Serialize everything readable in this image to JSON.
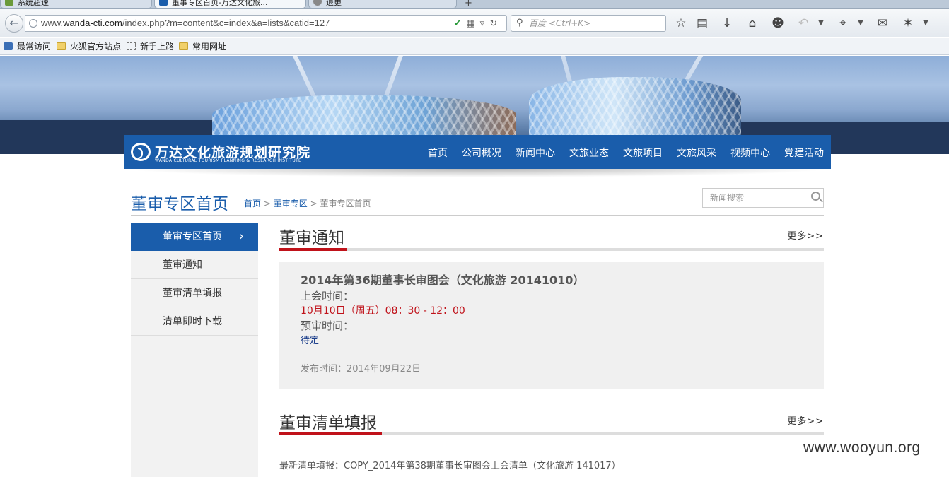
{
  "browser": {
    "tabs": [
      {
        "title": "系统超速"
      },
      {
        "title": "董事专区首页-万达文化旅..."
      },
      {
        "title": "退更"
      }
    ],
    "url_prefix": "www.",
    "url_domain": "wanda-cti.com",
    "url_path": "/index.php?m=content&c=index&a=lists&catid=127",
    "search_placeholder": "百度 <Ctrl+K>",
    "bookmarks": [
      "最常访问",
      "火狐官方站点",
      "新手上路",
      "常用网址"
    ]
  },
  "site": {
    "logo_cn": "万达文化旅游规划研究院",
    "logo_en": "WANDA CULTURAL TOURISM PLANNING & RESEARCH INSTITUTE",
    "nav": [
      "首页",
      "公司概况",
      "新闻中心",
      "文旅业态",
      "文旅项目",
      "文旅风采",
      "视频中心",
      "党建活动"
    ]
  },
  "page": {
    "title": "董审专区首页",
    "crumb_home": "首页",
    "crumb_sep": ">",
    "crumb_section": "董审专区",
    "crumb_current": "董审专区首页",
    "search_placeholder": "新闻搜索"
  },
  "sidebar": {
    "items": [
      {
        "label": "董审专区首页",
        "active": true
      },
      {
        "label": "董审通知"
      },
      {
        "label": "董审清单填报"
      },
      {
        "label": "清单即时下载"
      }
    ]
  },
  "notice": {
    "section_title": "董审通知",
    "more": "更多>>",
    "title": "2014年第36期董事长审图会（文化旅游 20141010）",
    "meeting_label": "上会时间：",
    "meeting_time": "10月10日（周五）08：30 - 12：00",
    "review_label": "预审时间：",
    "review_time": "待定",
    "published": "发布时间：2014年09月22日"
  },
  "checklist": {
    "section_title": "董审清单填报",
    "more": "更多>>",
    "latest": "最新清单填报：COPY_2014年第38期董事长审图会上会清单（文化旅游 141017）"
  },
  "watermark": "www.wooyun.org",
  "colors": {
    "brand_blue": "#1a5dab",
    "accent_red": "#c0121a"
  }
}
